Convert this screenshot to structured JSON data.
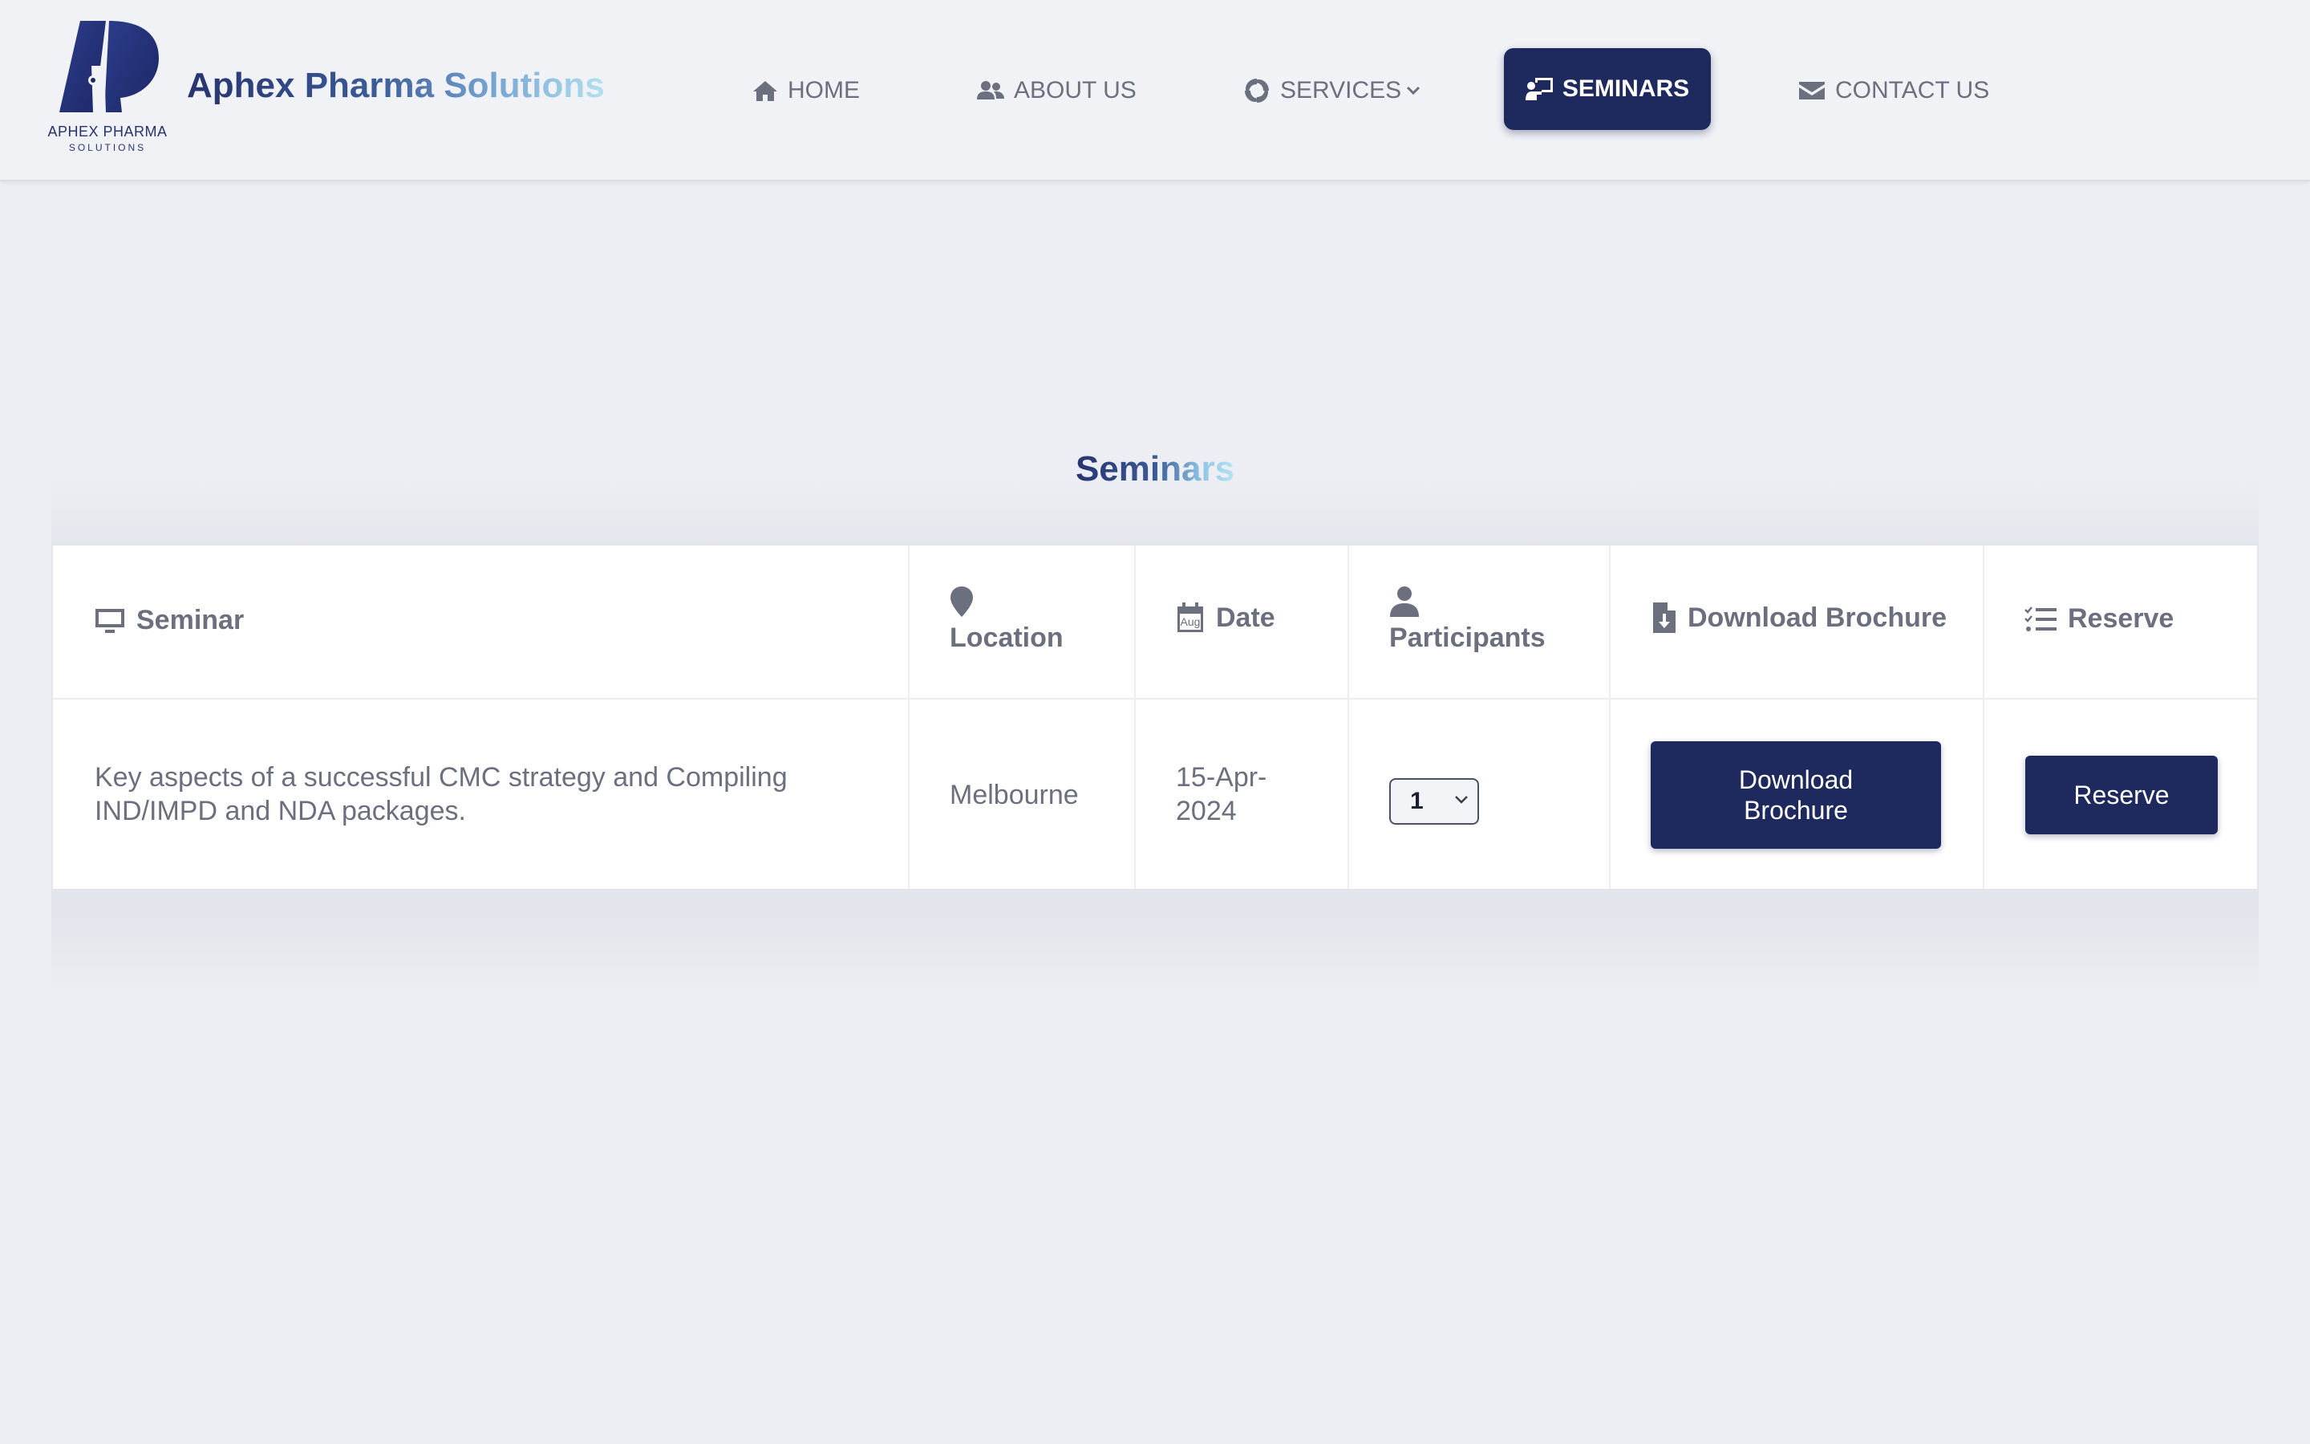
{
  "brand": {
    "logo_line1": "APHEX PHARMA",
    "logo_line2": "SOLUTIONS",
    "name": "Aphex Pharma Solutions"
  },
  "nav": {
    "items": [
      {
        "label": "HOME",
        "icon": "home-icon"
      },
      {
        "label": "ABOUT US",
        "icon": "users-icon"
      },
      {
        "label": "SERVICES",
        "icon": "swirl-icon",
        "dropdown": true
      },
      {
        "label": "SEMINARS",
        "icon": "presentation-icon",
        "active": true
      },
      {
        "label": "CONTACT US",
        "icon": "envelope-icon"
      }
    ]
  },
  "page": {
    "title": "Seminars"
  },
  "table": {
    "headers": [
      {
        "label": "Seminar",
        "icon": "monitor-icon"
      },
      {
        "label": "Location",
        "icon": "map-pin-icon"
      },
      {
        "label": "Date",
        "icon": "calendar-icon",
        "icon_text": "Aug"
      },
      {
        "label": "Participants",
        "icon": "user-icon"
      },
      {
        "label": "Download Brochure",
        "icon": "file-download-icon"
      },
      {
        "label": "Reserve",
        "icon": "checklist-icon"
      }
    ],
    "rows": [
      {
        "seminar": "Key aspects of a successful CMC strategy and Compiling IND/IMPD and NDA packages.",
        "location": "Melbourne",
        "date": "15-Apr-2024",
        "participants": "1",
        "download_label": "Download Brochure",
        "reserve_label": "Reserve"
      }
    ]
  },
  "colors": {
    "accent": "#1e2a5e",
    "background": "#eceef3",
    "text": "#6b6f7e"
  }
}
